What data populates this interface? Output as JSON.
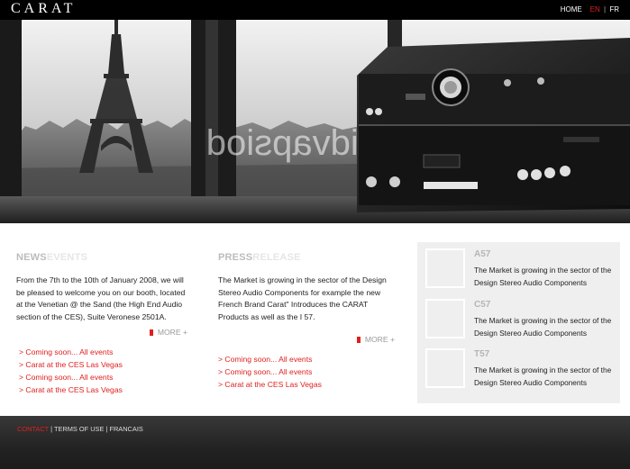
{
  "header": {
    "logo": "CARAT",
    "nav": {
      "home": "HOME",
      "en": "EN",
      "sep": "|",
      "fr": "FR"
    }
  },
  "hero": {
    "overlay_text": "pidvapsiod"
  },
  "news": {
    "heading_main": "NEWS",
    "heading_sub": "EVENTS",
    "body": "From the 7th to the 10th of January 2008, we will be pleased to welcome you on our booth, located at the Venetian @ the Sand (the High End Audio section of the CES), Suite Veronese 2501A.",
    "more": "MORE +",
    "links": [
      "> Coming soon... All events",
      "> Carat at the CES Las Vegas",
      "> Coming soon... All events",
      "> Carat at the CES Las Vegas"
    ]
  },
  "press": {
    "heading_main": "PRESS",
    "heading_sub": "RELEASE",
    "body": "The Market is growing in the sector of the Design Stereo Audio Components for example the new French Brand Carat\" Introduces the CARAT Products as well as the I 57.",
    "more": "MORE +",
    "links": [
      "> Coming soon... All events",
      "> Coming soon... All events",
      "> Carat at the CES Las Vegas"
    ]
  },
  "products": [
    {
      "name": "A57",
      "desc": "The Market is growing in the sector of the Design Stereo Audio Components"
    },
    {
      "name": "C57",
      "desc": "The Market is growing in the sector of the Design Stereo Audio Components"
    },
    {
      "name": "T57",
      "desc": "The Market is growing in the sector of the Design Stereo Audio Components"
    }
  ],
  "footer": {
    "contact": "CONTACT",
    "terms": "TERMS OF USE",
    "francais": "FRANCAIS",
    "sep": "|"
  },
  "colors": {
    "accent": "#e02020",
    "black": "#000000",
    "panel": "#efefef",
    "footer": "#2a2a2a"
  }
}
